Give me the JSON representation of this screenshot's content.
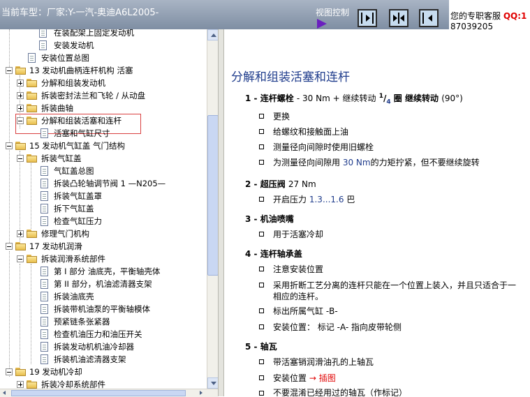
{
  "header": {
    "car_label": "当前车型：厂家:Y-一汽-奥迪A6L2005-",
    "view_control": "视图控制",
    "service_label": "您的专职客服",
    "service_qq": "QQ:1",
    "service_number": "87039205"
  },
  "tree": [
    {
      "label": "在装配架上固定发动机",
      "type": "doc"
    },
    {
      "label": "安装发动机",
      "type": "doc"
    },
    {
      "label": "安装位置总图",
      "type": "doc"
    },
    {
      "label": "13 发动机曲柄连杆机构 活塞",
      "type": "folder"
    },
    {
      "label": "分解和组装发动机",
      "type": "folder"
    },
    {
      "label": "拆装密封法兰和飞轮 / 从动盘",
      "type": "folder"
    },
    {
      "label": "拆装曲轴",
      "type": "folder"
    },
    {
      "label": "分解和组装活塞和连杆",
      "type": "folder"
    },
    {
      "label": "活塞和气缸尺寸",
      "type": "doc"
    },
    {
      "label": "15 发动机气缸盖 气门结构",
      "type": "folder"
    },
    {
      "label": "拆装气缸盖",
      "type": "folder"
    },
    {
      "label": "气缸盖总图",
      "type": "doc"
    },
    {
      "label": "拆装凸轮轴调节阀 1 —N205—",
      "type": "doc"
    },
    {
      "label": "拆装气缸盖罩",
      "type": "doc"
    },
    {
      "label": "拆下气缸盖",
      "type": "doc"
    },
    {
      "label": "检查气缸压力",
      "type": "doc"
    },
    {
      "label": "修理气门机构",
      "type": "folder"
    },
    {
      "label": "17 发动机润滑",
      "type": "folder"
    },
    {
      "label": "拆装润滑系统部件",
      "type": "folder"
    },
    {
      "label": "第 I 部分 油底壳，平衡轴壳体",
      "type": "doc"
    },
    {
      "label": "第 II 部分，机油滤清器支架",
      "type": "doc"
    },
    {
      "label": "拆装油底壳",
      "type": "doc"
    },
    {
      "label": "拆装带机油泵的平衡轴模体",
      "type": "doc"
    },
    {
      "label": "预紧链条张紧器",
      "type": "doc"
    },
    {
      "label": "检查机油压力和油压开关",
      "type": "doc"
    },
    {
      "label": "拆装发动机机油冷却器",
      "type": "doc"
    },
    {
      "label": "拆装机油滤清器支架",
      "type": "doc"
    },
    {
      "label": "19 发动机冷却",
      "type": "folder"
    },
    {
      "label": "拆装冷却系统部件",
      "type": "folder"
    }
  ],
  "content": {
    "title": "分解和组装活塞和连杆",
    "s1_num": "1 -",
    "s1_a": "连杆螺栓",
    "s1_b": "- 30 Nm + 继续转动",
    "s1_sup": "1",
    "s1_slash": "/",
    "s1_sub": "4",
    "s1_c": "圈",
    "s1_d": "继续转动",
    "s1_e": "(90°)",
    "s1_items": [
      "更换",
      "给螺纹和接触面上油",
      "测量径向间隙时使用旧螺栓"
    ],
    "s1_i4a": "为测量径向间隙用",
    "s1_i4b": "30 Nm",
    "s1_i4c": "的力矩拧紧，但不要继续旋转",
    "s2_num": "2 -",
    "s2_a": "超压阀",
    "s2_b": "27 Nm",
    "s2_i1a": "开启压力",
    "s2_i1b": "1.3",
    "s2_i1c": "...",
    "s2_i1d": "1.6",
    "s2_i1e": "巴",
    "s3_num": "3 -",
    "s3_a": "机油喷嘴",
    "s3_i1": "用于活塞冷却",
    "s4_num": "4 -",
    "s4_a": "连杆轴承盖",
    "s4_i1": "注意安装位置",
    "s4_i2a": "采用折断工艺分离的连杆只能在一个位置上装入，并且只适合于一",
    "s4_i2b": "相应的连杆。",
    "s4_i3": "标出所属气缸 -B-",
    "s4_i4": "安装位置： 标记 -A- 指向皮带轮侧",
    "s5_num": "5 -",
    "s5_a": "轴瓦",
    "s5_i1": "带活塞销润滑油孔的上轴瓦",
    "s5_i2a": "安装位置",
    "s5_i2b": "→ 插图",
    "s5_i3": "不要混淆已经用过的轴瓦（作标记）"
  },
  "colors": {
    "title": "#1f3c8c",
    "link": "#e00000",
    "selection": "#d94040"
  }
}
